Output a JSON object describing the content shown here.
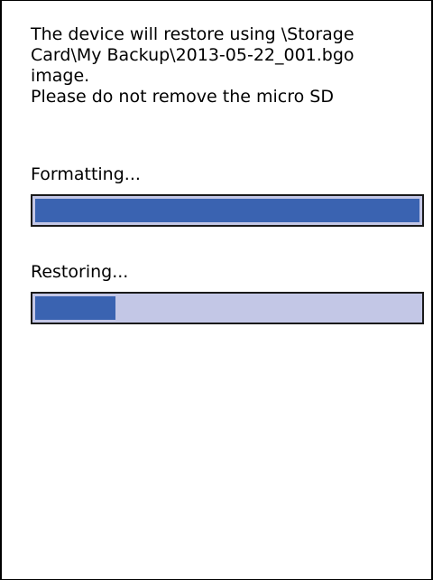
{
  "message": {
    "line1": "The device will restore using \\Storage",
    "line2": "Card\\My Backup\\2013-05-22_001.bgo",
    "line3": "image.",
    "line4": "Please do not remove the micro SD"
  },
  "steps": [
    {
      "label": "Formatting...",
      "progress": 1.0
    },
    {
      "label": "Restoring...",
      "progress": 0.21
    }
  ],
  "colors": {
    "bar_fill": "#3a63b1",
    "bar_track": "#c3c7e6",
    "bar_border": "#1a1a1a",
    "background": "#ffffff",
    "text": "#000000"
  }
}
